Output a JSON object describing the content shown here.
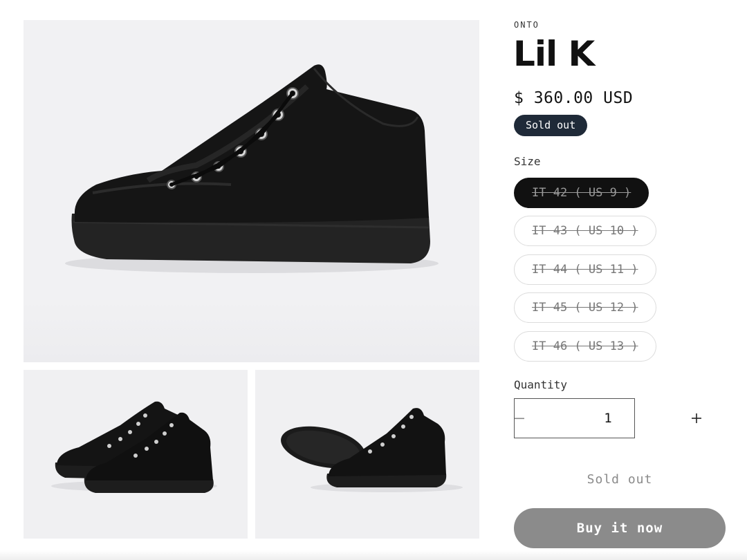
{
  "product": {
    "vendor": "ONTO",
    "title": "Lil K",
    "price": "$ 360.00 USD",
    "badge": "Sold out"
  },
  "size": {
    "label": "Size",
    "options": [
      {
        "label": "IT 42 ( US 9 )",
        "selected": true,
        "available": false
      },
      {
        "label": "IT 43 ( US 10 )",
        "selected": false,
        "available": false
      },
      {
        "label": "IT 44 ( US 11 )",
        "selected": false,
        "available": false
      },
      {
        "label": "IT 45 ( US 12 )",
        "selected": false,
        "available": false
      },
      {
        "label": "IT 46 ( US 13 )",
        "selected": false,
        "available": false
      }
    ]
  },
  "quantity": {
    "label": "Quantity",
    "value": "1",
    "minus_icon": "minus-icon",
    "plus_icon": "plus-icon"
  },
  "actions": {
    "sold_out_label": "Sold out",
    "buy_now_label": "Buy it now"
  },
  "colors": {
    "badge_bg": "#1f2a38",
    "selected_pill_bg": "#111111",
    "buy_button_bg": "#8b8b8b",
    "media_bg": "#f0f0f2"
  }
}
